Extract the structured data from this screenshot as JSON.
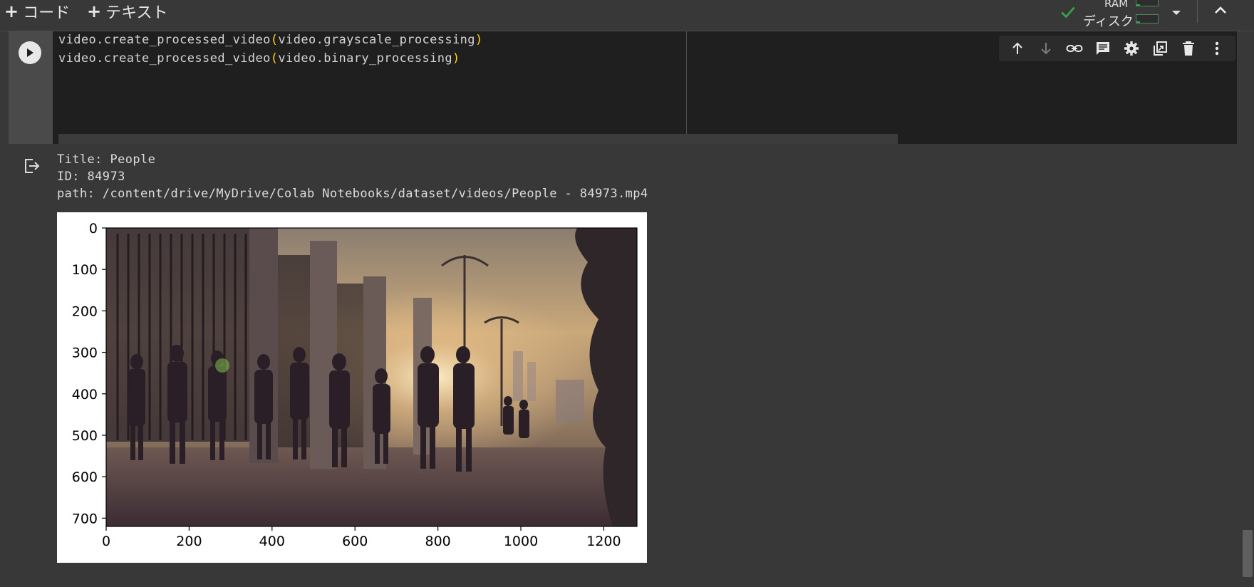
{
  "toolbar": {
    "add_code_label": "コード",
    "add_text_label": "テキスト",
    "ram_label": "RAM",
    "disk_label": "ディスク",
    "ram_usage": 0.15,
    "disk_usage": 0.15
  },
  "cell": {
    "code_lines": [
      {
        "prefix": "video.create_processed_video",
        "arg": "video.grayscale_processing"
      },
      {
        "prefix": "video.create_processed_video",
        "arg": "video.binary_processing"
      }
    ],
    "toolbar_icons": [
      "arrow-up-icon",
      "arrow-down-icon",
      "link-icon",
      "comment-icon",
      "gear-icon",
      "mirror-cell-icon",
      "trash-icon",
      "more-vert-icon"
    ]
  },
  "output": {
    "lines": [
      "Title: People",
      "ID: 84973",
      "path: /content/drive/MyDrive/Colab Notebooks/dataset/videos/People - 84973.mp4"
    ]
  },
  "chart_data": {
    "type": "image",
    "title": "",
    "xlabel": "",
    "ylabel": "",
    "x_ticks": [
      0,
      200,
      400,
      600,
      800,
      1000,
      1200
    ],
    "y_ticks": [
      0,
      100,
      200,
      300,
      400,
      500,
      600,
      700
    ],
    "xlim": [
      0,
      1280
    ],
    "ylim": [
      720,
      0
    ]
  },
  "colors": {
    "accent_green": "#37a34a",
    "code_paren": "#ffd700",
    "editor_bg": "#1f1f1f"
  }
}
